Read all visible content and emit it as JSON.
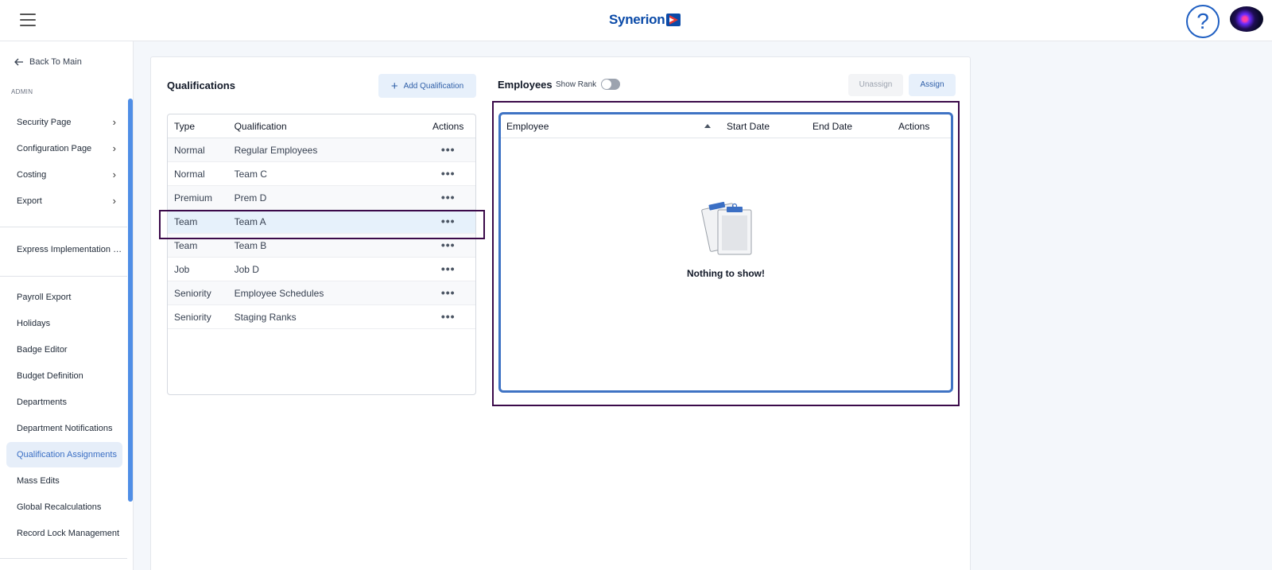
{
  "header": {
    "logo_text": "Synerion",
    "help_label": "?"
  },
  "sidebar": {
    "back_label": "Back To Main",
    "section_label": "ADMIN",
    "group1": [
      {
        "label": "Security Page"
      },
      {
        "label": "Configuration Page"
      },
      {
        "label": "Costing"
      },
      {
        "label": "Export"
      }
    ],
    "group2": [
      {
        "label": "Express Implementation P..."
      }
    ],
    "group3": [
      {
        "label": "Payroll Export"
      },
      {
        "label": "Holidays"
      },
      {
        "label": "Badge Editor"
      },
      {
        "label": "Budget Definition"
      },
      {
        "label": "Departments"
      },
      {
        "label": "Department Notifications"
      },
      {
        "label": "Qualification Assignments",
        "active": true
      },
      {
        "label": "Mass Edits"
      },
      {
        "label": "Global Recalculations"
      },
      {
        "label": "Record Lock Management"
      }
    ]
  },
  "qualifications": {
    "title": "Qualifications",
    "add_label": "Add Qualification",
    "columns": {
      "type": "Type",
      "qualification": "Qualification",
      "actions": "Actions"
    },
    "rows": [
      {
        "type": "Normal",
        "qualification": "Regular Employees"
      },
      {
        "type": "Normal",
        "qualification": "Team C"
      },
      {
        "type": "Premium",
        "qualification": "Prem D"
      },
      {
        "type": "Team",
        "qualification": "Team A",
        "selected": true
      },
      {
        "type": "Team",
        "qualification": "Team B"
      },
      {
        "type": "Job",
        "qualification": "Job D"
      },
      {
        "type": "Seniority",
        "qualification": "Employee Schedules"
      },
      {
        "type": "Seniority",
        "qualification": "Staging Ranks"
      }
    ],
    "actions_glyph": "•••"
  },
  "employees": {
    "title": "Employees",
    "show_rank_label": "Show Rank",
    "show_rank_on": false,
    "unassign_label": "Unassign",
    "assign_label": "Assign",
    "columns": {
      "employee": "Employee",
      "start_date": "Start Date",
      "end_date": "End Date",
      "actions": "Actions"
    },
    "empty_text": "Nothing to show!"
  },
  "colors": {
    "brand": "#0a4aa8",
    "accent": "#3f73c4",
    "highlight_outline": "#3b0a4a",
    "active_nav_bg": "#e6eef9"
  }
}
